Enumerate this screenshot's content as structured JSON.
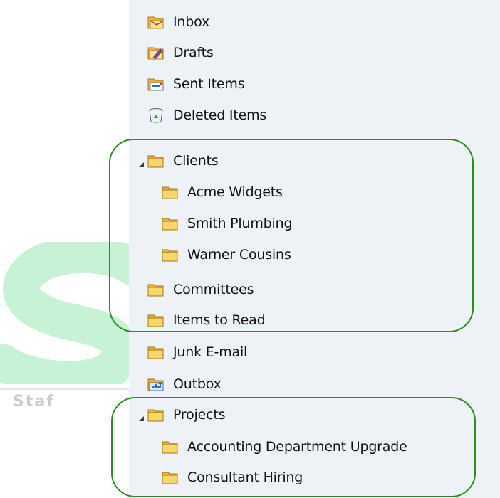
{
  "folders": {
    "inbox": {
      "label": "Inbox",
      "icon": "inbox-icon"
    },
    "drafts": {
      "label": "Drafts",
      "icon": "drafts-icon"
    },
    "sent_items": {
      "label": "Sent Items",
      "icon": "sent-items-icon"
    },
    "deleted_items": {
      "label": "Deleted Items",
      "icon": "recycle-bin-icon"
    },
    "clients": {
      "label": "Clients",
      "icon": "folder-icon",
      "expanded": true,
      "children": [
        {
          "label": "Acme Widgets",
          "icon": "folder-icon"
        },
        {
          "label": "Smith Plumbing",
          "icon": "folder-icon"
        },
        {
          "label": "Warner Cousins",
          "icon": "folder-icon"
        }
      ]
    },
    "committees": {
      "label": "Committees",
      "icon": "folder-icon"
    },
    "items_to_read": {
      "label": "Items to Read",
      "icon": "folder-icon"
    },
    "junk_email": {
      "label": "Junk E-mail",
      "icon": "folder-icon"
    },
    "outbox": {
      "label": "Outbox",
      "icon": "outbox-icon"
    },
    "projects": {
      "label": "Projects",
      "icon": "folder-icon",
      "expanded": true,
      "children": [
        {
          "label": "Accounting Department Upgrade",
          "icon": "folder-icon"
        },
        {
          "label": "Consultant Hiring",
          "icon": "folder-icon"
        }
      ]
    }
  },
  "watermark": {
    "text": "Staf"
  },
  "colors": {
    "pane_background": "#eef1f5",
    "highlight_border": "#2e8a22",
    "folder_yellow": "#f5cf5a",
    "watermark_green": "#bdf0cc"
  }
}
